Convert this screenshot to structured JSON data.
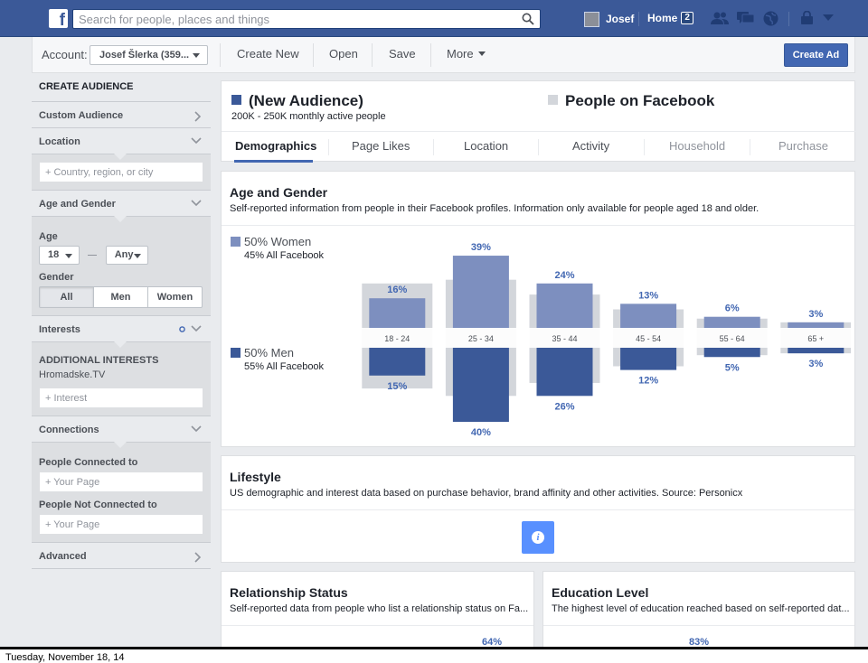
{
  "topbar": {
    "search_placeholder": "Search for people, places and things",
    "user_name": "Josef",
    "home_label": "Home",
    "home_badge": "2",
    "brand_color": "#3b5998"
  },
  "toolbar": {
    "account_label": "Account:",
    "account_value": "Josef Šlerka (359...",
    "create_new": "Create New",
    "open": "Open",
    "save": "Save",
    "more": "More",
    "create_ad": "Create Ad"
  },
  "sidebar": {
    "header": "CREATE AUDIENCE",
    "custom_audience": "Custom Audience",
    "location": "Location",
    "location_placeholder": "Country, region, or city",
    "age_gender": "Age and Gender",
    "age_label": "Age",
    "age_min": "18",
    "age_max": "Any",
    "gender_label": "Gender",
    "gender_options": [
      "All",
      "Men",
      "Women"
    ],
    "gender_selected": "All",
    "interests": "Interests",
    "additional_interests": "ADDITIONAL INTERESTS",
    "interest_value": "Hromadske.TV",
    "interest_placeholder": "Interest",
    "connections": "Connections",
    "people_connected": "People Connected to",
    "people_not_connected": "People Not Connected to",
    "page_placeholder": "Your Page",
    "advanced": "Advanced"
  },
  "audience": {
    "new_title": "(New Audience)",
    "new_subtitle": "200K - 250K monthly active people",
    "compare_title": "People on Facebook",
    "new_color": "#3b5998",
    "compare_color": "#d3d6db"
  },
  "tabs": [
    "Demographics",
    "Page Likes",
    "Location",
    "Activity",
    "Household",
    "Purchase"
  ],
  "active_tab": "Demographics",
  "age_gender": {
    "title": "Age and Gender",
    "subtitle": "Self-reported information from people in their Facebook profiles. Information only available for people aged 18 and older.",
    "women_label": "50% Women",
    "women_sub": "45% All Facebook",
    "men_label": "50% Men",
    "men_sub": "55% All Facebook"
  },
  "chart_data": {
    "type": "bar",
    "categories": [
      "18 - 24",
      "25 - 34",
      "35 - 44",
      "45 - 54",
      "55 - 64",
      "65 +"
    ],
    "series": [
      {
        "name": "50% Women",
        "values": [
          16,
          39,
          24,
          13,
          6,
          3
        ],
        "labels": [
          "16%",
          "39%",
          "24%",
          "13%",
          "6%",
          "3%"
        ],
        "color": "#7d8fbf"
      },
      {
        "name": "50% Men",
        "values": [
          15,
          40,
          26,
          12,
          5,
          3
        ],
        "labels": [
          "15%",
          "40%",
          "26%",
          "12%",
          "5%",
          "3%"
        ],
        "color": "#3b5998"
      }
    ],
    "baseline_women": [
      24,
      26,
      18,
      10,
      5,
      3
    ],
    "baseline_men": [
      22,
      26,
      19,
      10,
      4,
      3
    ],
    "baseline_color": "#d3d6db",
    "ylim": [
      0,
      45
    ]
  },
  "lifestyle": {
    "title": "Lifestyle",
    "subtitle": "US demographic and interest data based on purchase behavior, brand affinity and other activities. Source: Personicx",
    "info_icon": "info-icon"
  },
  "relationship": {
    "title": "Relationship Status",
    "subtitle": "Self-reported data from people who list a relationship status on Fa...",
    "peak_label": "64%"
  },
  "education": {
    "title": "Education Level",
    "subtitle": "The highest level of education reached based on self-reported dat...",
    "peak_label": "83%"
  },
  "footer_date": "Tuesday, November 18, 14"
}
